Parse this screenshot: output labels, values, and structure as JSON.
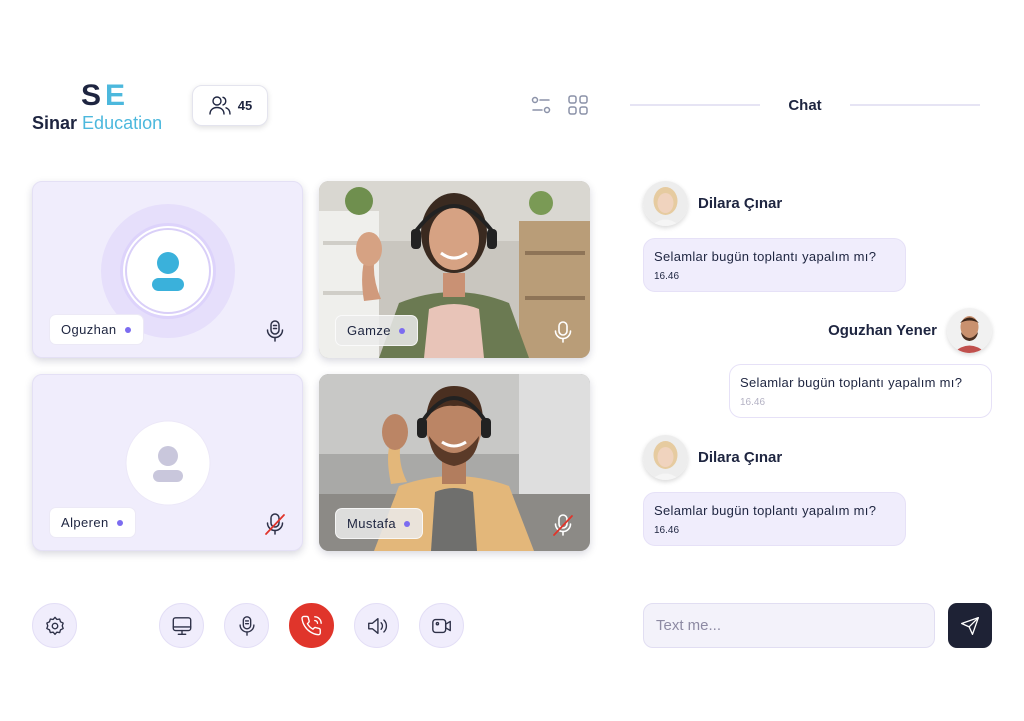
{
  "brand": {
    "mark_s": "S",
    "mark_e": "E",
    "name_a": "Sinar",
    "name_b": "Education"
  },
  "header": {
    "participants_count": "45",
    "chat_title": "Chat"
  },
  "tiles": [
    {
      "name": "Oguzhan",
      "mic": "on",
      "video": "off"
    },
    {
      "name": "Gamze",
      "mic": "on",
      "video": "on"
    },
    {
      "name": "Alperen",
      "mic": "muted",
      "video": "off"
    },
    {
      "name": "Mustafa",
      "mic": "muted",
      "video": "on"
    }
  ],
  "messages": [
    {
      "sender": "Dilara Çınar",
      "text": "Selamlar bugün toplantı yapalım mı?",
      "time": "16.46",
      "direction": "incoming"
    },
    {
      "sender": "Oguzhan Yener",
      "text": "Selamlar bugün toplantı yapalım mı?",
      "time": "16.46",
      "direction": "outgoing"
    },
    {
      "sender": "Dilara Çınar",
      "text": "Selamlar bugün toplantı yapalım mı?",
      "time": "16.46",
      "direction": "incoming"
    }
  ],
  "composer": {
    "placeholder": "Text me..."
  },
  "colors": {
    "accent": "#7c6cf0",
    "brand_dark": "#1e2540",
    "brand_light": "#4cb8dd",
    "end_call": "#e0352b",
    "tile_bg": "#f0edfc"
  },
  "icons": [
    "users-icon",
    "filter-icon",
    "grid-icon",
    "settings-icon",
    "screen-share-icon",
    "mic-icon",
    "end-call-icon",
    "speaker-icon",
    "camera-icon",
    "send-icon"
  ]
}
